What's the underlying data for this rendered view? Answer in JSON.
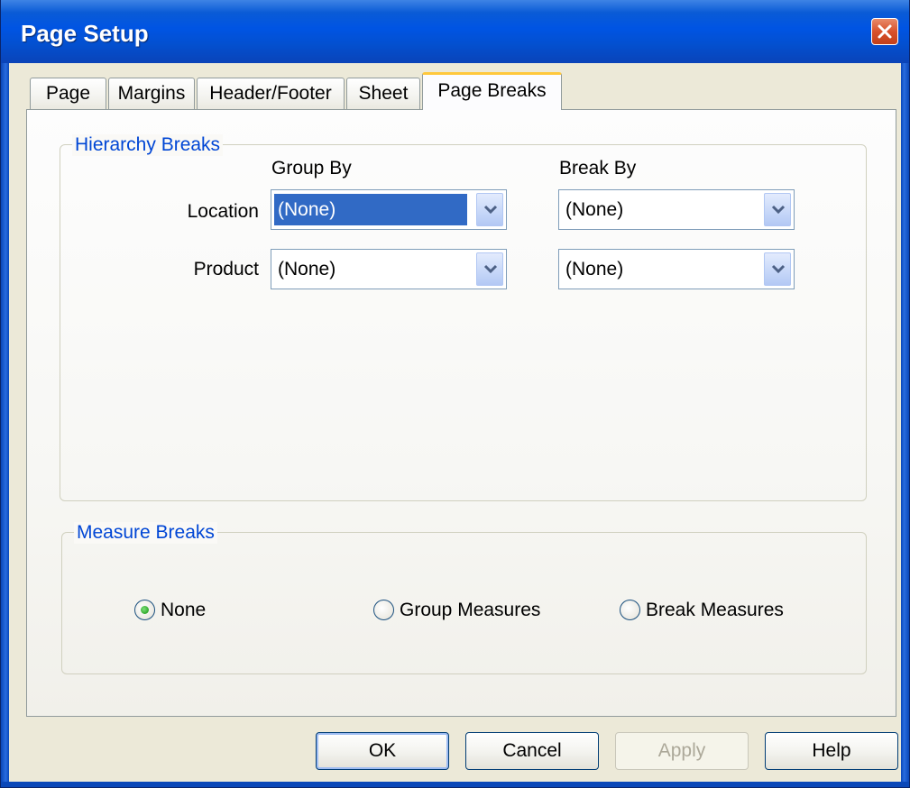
{
  "window": {
    "title": "Page Setup",
    "accent_color": "#0054e3",
    "close_icon": "close-icon"
  },
  "tabs": [
    {
      "label": "Page",
      "active": false
    },
    {
      "label": "Margins",
      "active": false
    },
    {
      "label": "Header/Footer",
      "active": false
    },
    {
      "label": "Sheet",
      "active": false
    },
    {
      "label": "Page Breaks",
      "active": true
    }
  ],
  "hierarchy_breaks": {
    "legend": "Hierarchy Breaks",
    "group_by_header": "Group By",
    "break_by_header": "Break By",
    "rows": [
      {
        "label": "Location",
        "group_by": "(None)",
        "break_by": "(None)"
      },
      {
        "label": "Product",
        "group_by": "(None)",
        "break_by": "(None)"
      }
    ]
  },
  "measure_breaks": {
    "legend": "Measure Breaks",
    "options": [
      {
        "label": "None",
        "selected": true
      },
      {
        "label": "Group Measures",
        "selected": false
      },
      {
        "label": "Break Measures",
        "selected": false
      }
    ]
  },
  "buttons": {
    "ok": "OK",
    "cancel": "Cancel",
    "apply": "Apply",
    "help": "Help"
  }
}
